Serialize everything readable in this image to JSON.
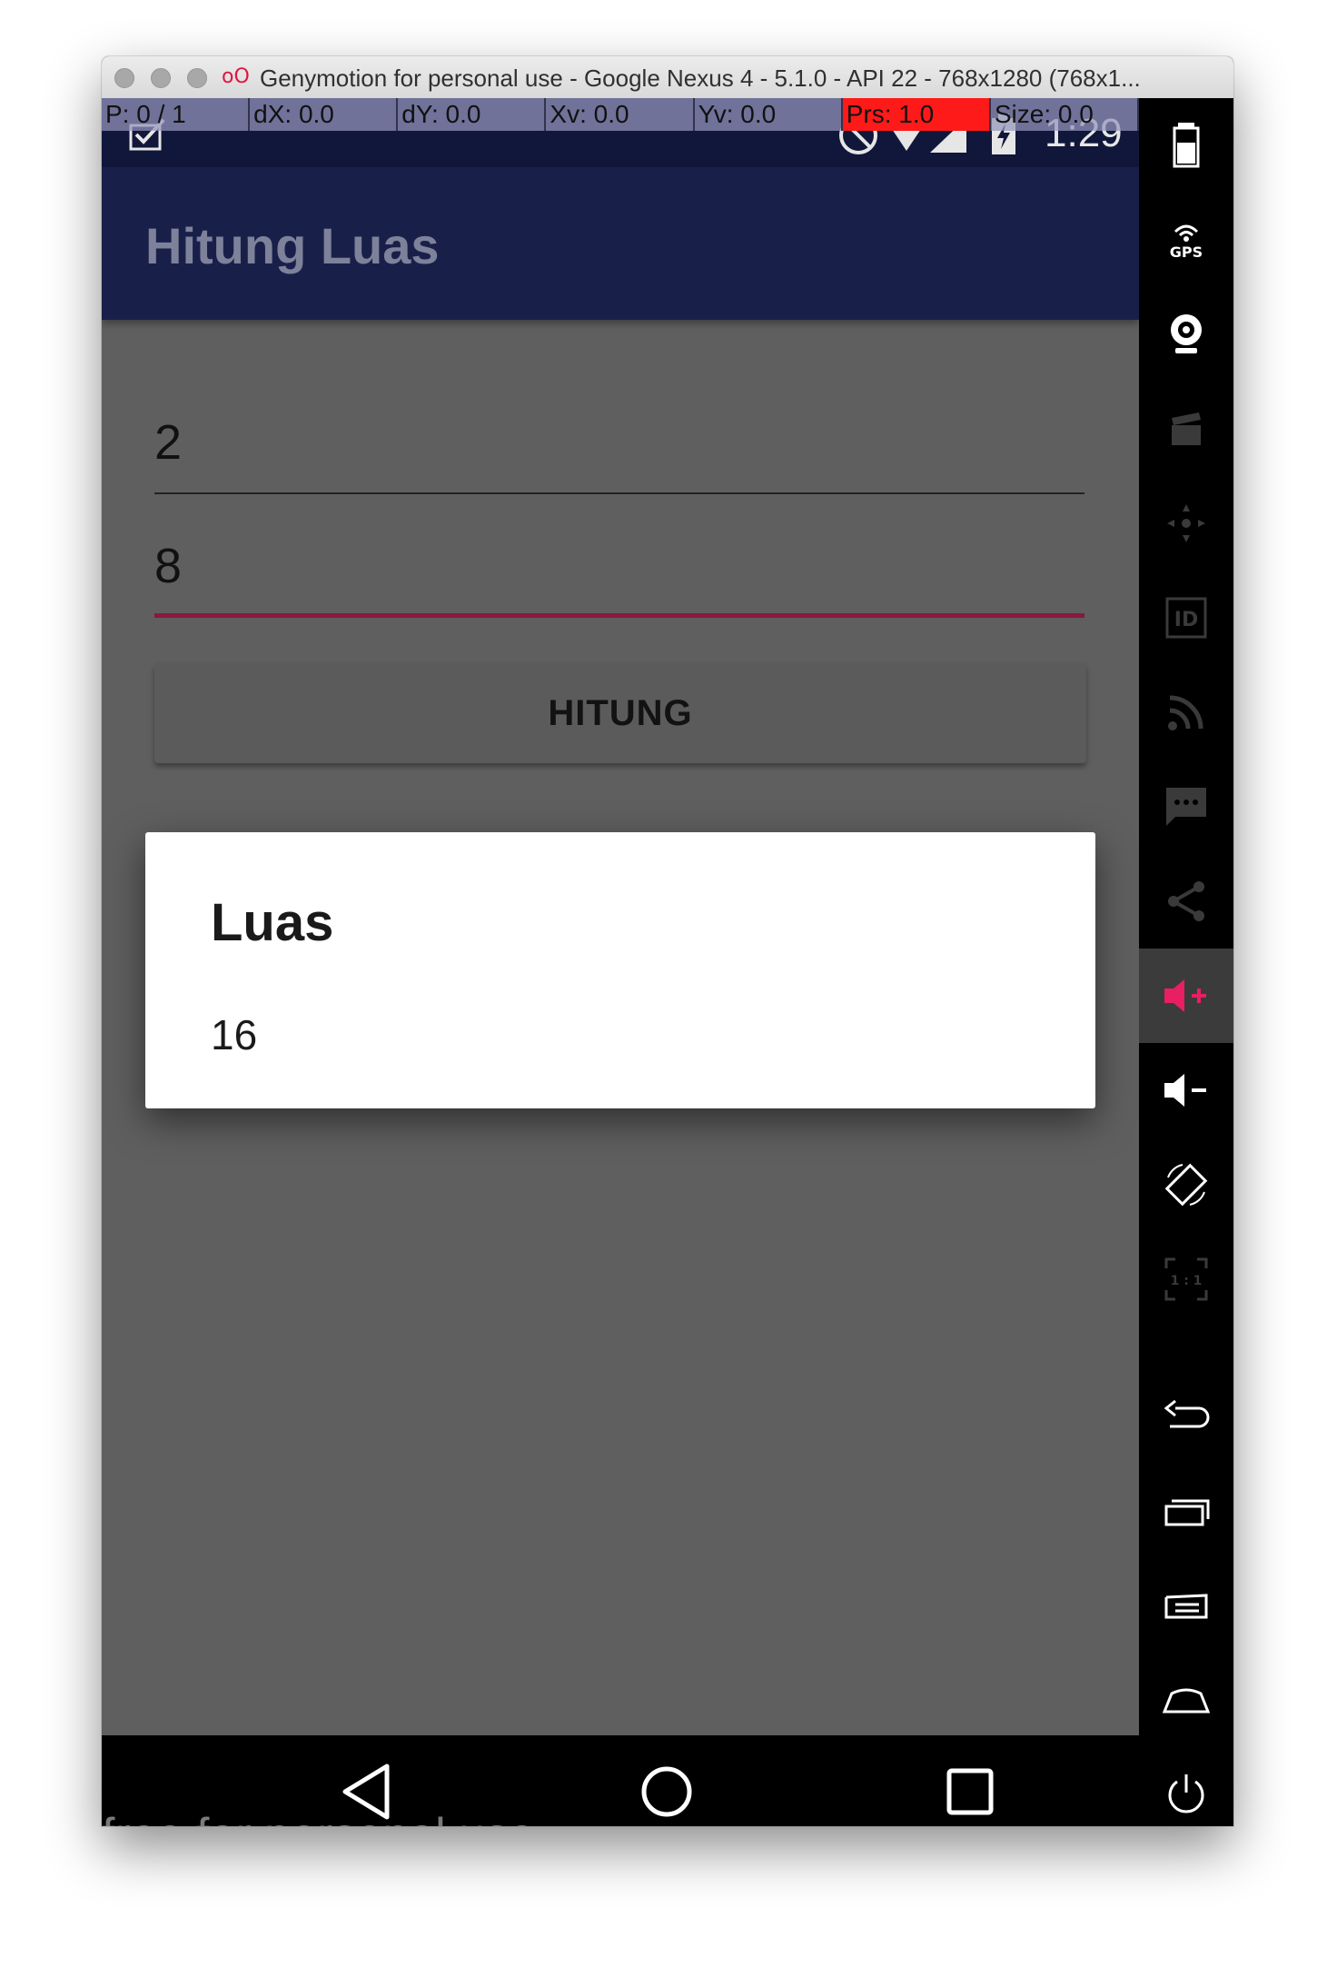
{
  "window": {
    "title": "Genymotion for personal use - Google Nexus 4 - 5.1.0 - API 22 - 768x1280 (768x1...",
    "logo_glyph": "oO"
  },
  "pointer_overlay": [
    "P: 0 / 1",
    "dX: 0.0",
    "dY: 0.0",
    "Xv: 0.0",
    "Yv: 0.0",
    "Prs: 1.0",
    "Size: 0.0"
  ],
  "status_bar": {
    "time": "1:29"
  },
  "app_bar": {
    "title": "Hitung Luas"
  },
  "form": {
    "field1_value": "2",
    "field2_value": "8",
    "button_label": "HITUNG"
  },
  "dialog": {
    "title": "Luas",
    "message": "16"
  },
  "watermark": "free for personal use",
  "sidebar": {
    "gps_label": "GPS",
    "id_label": "ID",
    "pixel_label": "1 : 1"
  },
  "colors": {
    "accent": "#e91e63",
    "app_bar": "#18204a",
    "dim_background": "#5f5f5f"
  }
}
